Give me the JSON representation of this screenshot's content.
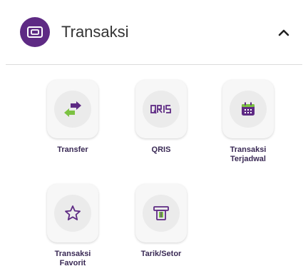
{
  "header": {
    "title": "Transaksi",
    "icon": "wallet-icon",
    "collapse_icon": "chevron-up-icon"
  },
  "colors": {
    "brand": "#5e2a84",
    "accent_green": "#7cc242",
    "label": "#3a2a55"
  },
  "menu": [
    {
      "label": "Transfer",
      "icon": "transfer-arrows-icon"
    },
    {
      "label": "QRIS",
      "icon": "qris-logo-icon"
    },
    {
      "label": "Transaksi\nTerjadwal",
      "icon": "calendar-icon"
    },
    {
      "label": "Transaksi\nFavorit",
      "icon": "star-icon"
    },
    {
      "label": "Tarik/Setor",
      "icon": "atm-icon"
    }
  ]
}
